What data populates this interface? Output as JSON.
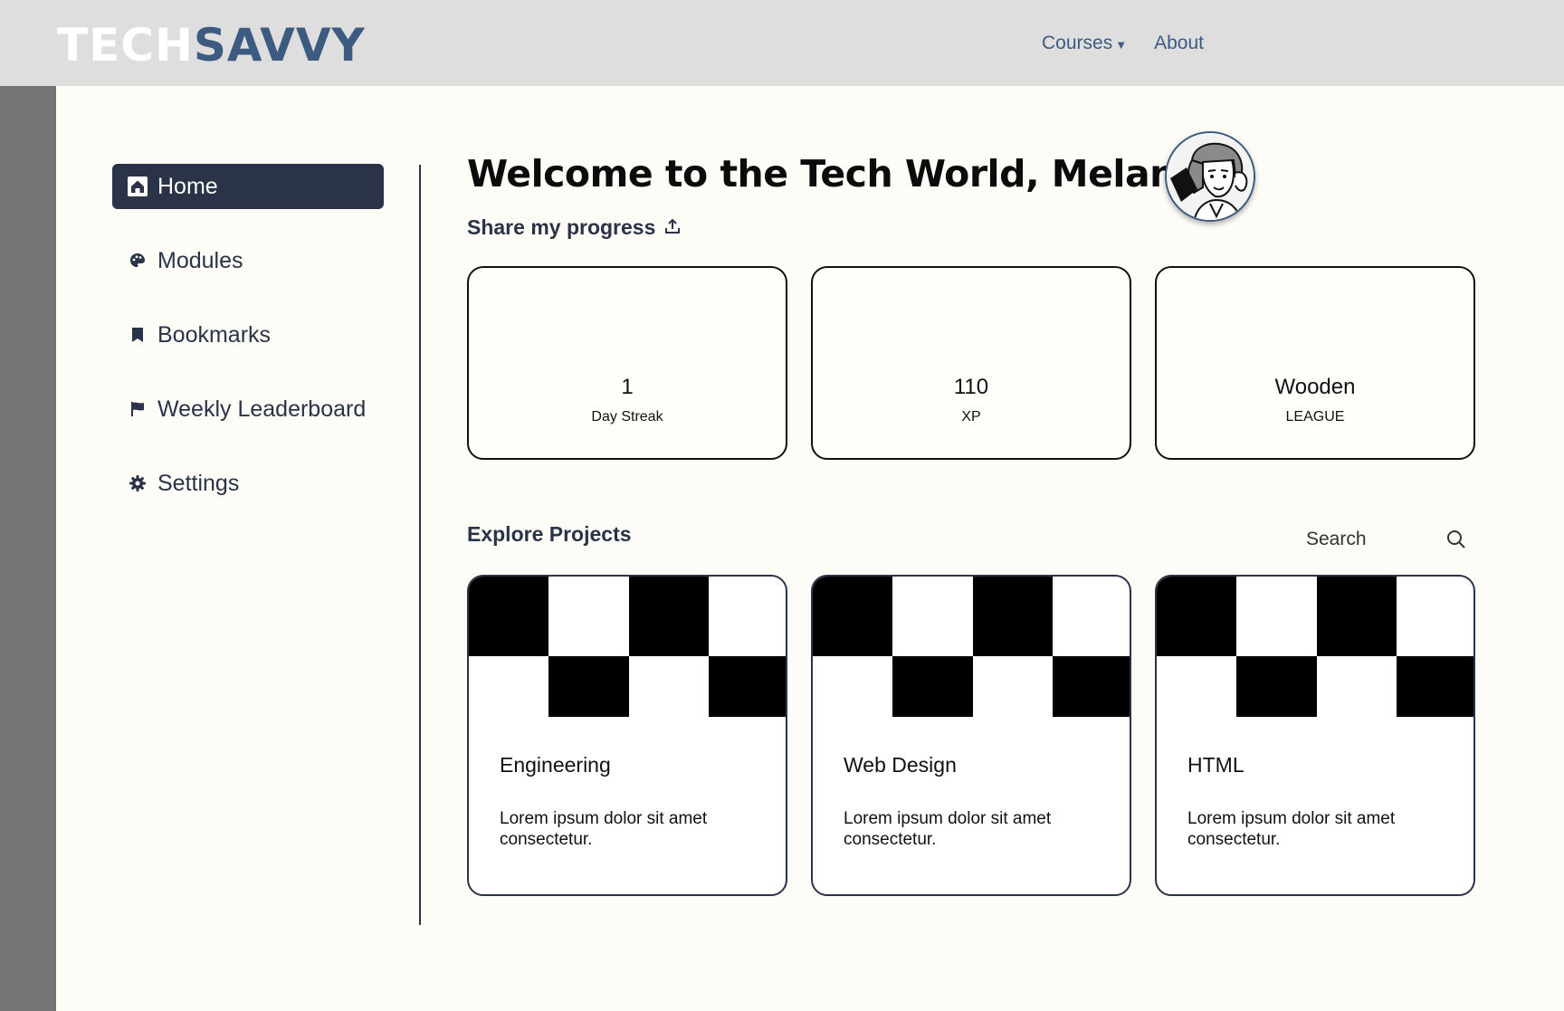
{
  "header": {
    "logo_part1": "TECH",
    "logo_part2": "SAVVY",
    "nav": [
      {
        "label": "Courses",
        "has_caret": true
      },
      {
        "label": "About"
      }
    ]
  },
  "sidebar": {
    "items": [
      {
        "label": "Home",
        "icon": "home-icon",
        "active": true
      },
      {
        "label": "Modules",
        "icon": "palette-icon"
      },
      {
        "label": "Bookmarks",
        "icon": "bookmark-icon"
      },
      {
        "label": "Weekly Leaderboard",
        "icon": "flag-icon"
      },
      {
        "label": "Settings",
        "icon": "gear-icon"
      }
    ]
  },
  "main": {
    "welcome": "Welcome to the Tech World, Melanie!",
    "share_label": "Share my progress",
    "stats": [
      {
        "value": "1",
        "caption": "Day Streak"
      },
      {
        "value": "110",
        "caption": "XP"
      },
      {
        "value": "Wooden",
        "caption": "LEAGUE"
      }
    ],
    "explore_title": "Explore Projects",
    "search_placeholder": "Search",
    "projects": [
      {
        "title": "Engineering",
        "desc": "Lorem ipsum dolor sit amet consectetur."
      },
      {
        "title": "Web Design",
        "desc": "Lorem ipsum dolor sit amet consectetur."
      },
      {
        "title": "HTML",
        "desc": "Lorem ipsum dolor sit amet consectetur."
      }
    ]
  },
  "colors": {
    "accent": "#3d5a80",
    "dark": "#2a3347",
    "topbar": "#dedede",
    "background": "#fdfcf7"
  }
}
